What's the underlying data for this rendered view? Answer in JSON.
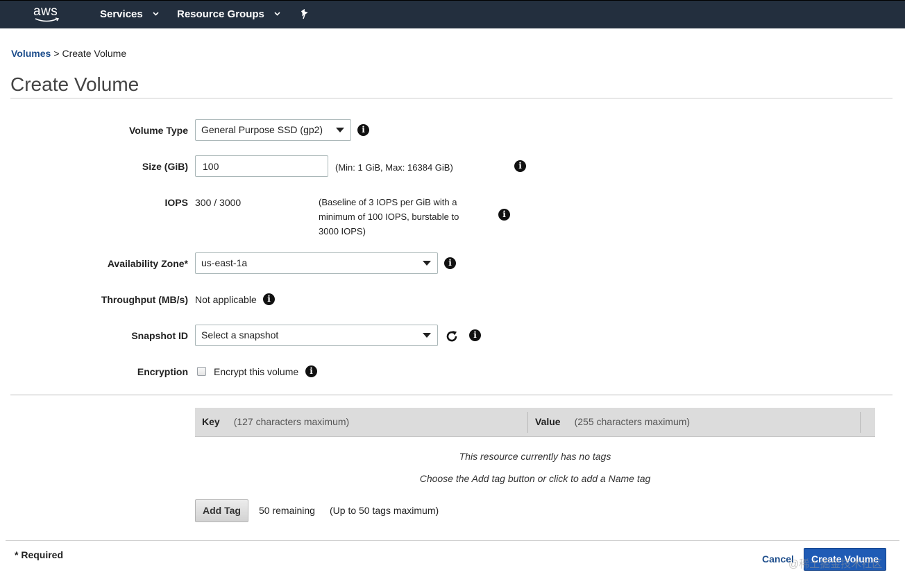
{
  "topnav": {
    "logo_text": "aws",
    "services_label": "Services",
    "resource_groups_label": "Resource Groups"
  },
  "breadcrumb": {
    "parent": "Volumes",
    "separator": ">",
    "current": "Create Volume"
  },
  "page": {
    "title": "Create Volume"
  },
  "form": {
    "volume_type": {
      "label": "Volume Type",
      "value": "General Purpose SSD (gp2)"
    },
    "size": {
      "label": "Size (GiB)",
      "value": "100",
      "hint": "(Min: 1 GiB, Max: 16384 GiB)"
    },
    "iops": {
      "label": "IOPS",
      "value": "300 / 3000",
      "hint_lines": [
        "(Baseline of 3 IOPS per GiB with a",
        "minimum of 100 IOPS, burstable to",
        "3000 IOPS)"
      ]
    },
    "availability_zone": {
      "label": "Availability Zone*",
      "value": "us-east-1a"
    },
    "throughput": {
      "label": "Throughput (MB/s)",
      "value": "Not applicable"
    },
    "snapshot": {
      "label": "Snapshot ID",
      "placeholder": "Select a snapshot"
    },
    "encryption": {
      "label": "Encryption",
      "checkbox_label": "Encrypt this volume",
      "checked": false
    }
  },
  "tags": {
    "key_header": "Key",
    "key_hint": "(127 characters maximum)",
    "value_header": "Value",
    "value_hint": "(255 characters maximum)",
    "empty_line1": "This resource currently has no tags",
    "empty_line2": "Choose the Add tag button or click to add a Name tag",
    "add_button": "Add Tag",
    "remaining": "50 remaining",
    "max_note": "(Up to 50 tags maximum)"
  },
  "footer": {
    "required_note": "* Required",
    "cancel_label": "Cancel",
    "create_label": "Create Volume",
    "watermark": "@稀土掘金技术社区"
  },
  "colors": {
    "nav_bg": "#232f3e",
    "link": "#1e4e8c",
    "primary_button": "#1f5bb5",
    "aws_smile": "#ff9900"
  },
  "icons": [
    "aws-logo",
    "chevron-down-icon",
    "pin-icon",
    "info-icon",
    "refresh-icon",
    "dropdown-caret-icon"
  ]
}
